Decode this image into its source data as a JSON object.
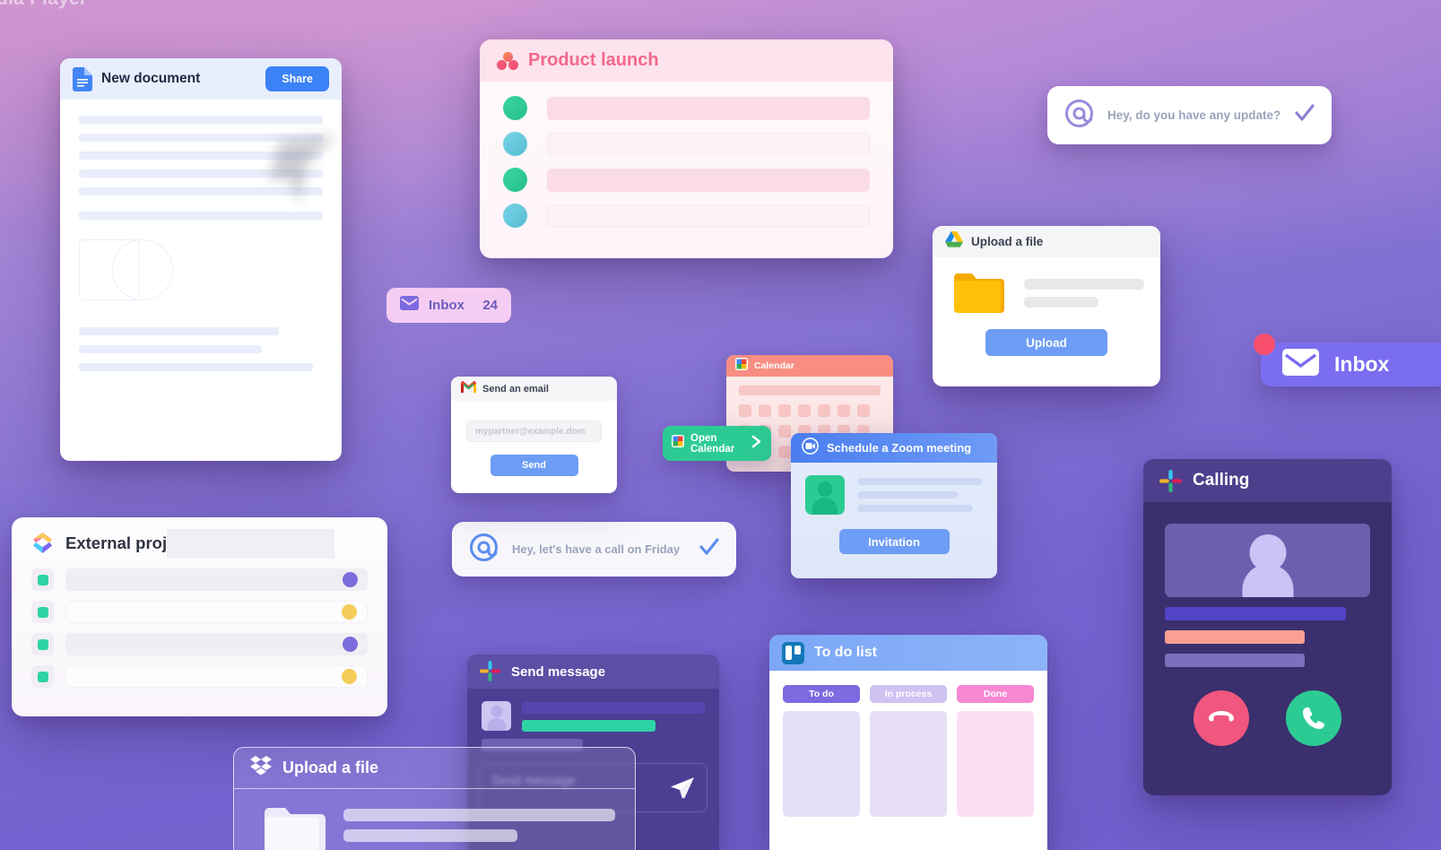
{
  "background": {
    "top_color": "#c48bc8",
    "bottom_color": "#7363cf"
  },
  "bleed_text": "dia Player",
  "document_card": {
    "icon": "google-docs-icon",
    "title": "New document",
    "share_label": "Share"
  },
  "product_launch": {
    "icon": "asana-icon",
    "title": "Product launch",
    "rows": [
      {
        "dot_color": "#2ec99a",
        "bar_color": "#fcdbe8"
      },
      {
        "dot_color": "#65c6dd",
        "bar_color": "#fdf3f7"
      },
      {
        "dot_color": "#2ec99a",
        "bar_color": "#fcdbe8"
      },
      {
        "dot_color": "#65c6dd",
        "bar_color": "#fdf3f7"
      }
    ]
  },
  "inbox_small": {
    "icon": "envelope-icon",
    "label": "Inbox",
    "count": "24"
  },
  "bubble_update": {
    "icon": "at-mention-icon",
    "text": "Hey, do you have any update?",
    "check_color": "#8f7fd8"
  },
  "bubble_call": {
    "icon": "at-mention-icon",
    "text": "Hey, let's have a call on Friday",
    "check_color": "#5b8df0"
  },
  "gdrive_upload": {
    "icon": "google-drive-icon",
    "title": "Upload a file",
    "button_label": "Upload",
    "button_color": "#6d9df4"
  },
  "gmail": {
    "icon": "gmail-icon",
    "title": "Send an email",
    "email_placeholder": "mypartner@example.dom",
    "email_value": "",
    "button_label": "Send"
  },
  "calendar": {
    "icon": "google-calendar-icon",
    "title": "Calendar",
    "header_color": "#f88e83"
  },
  "open_calendar": {
    "icon": "google-calendar-icon",
    "label": "Open Calendar",
    "chevron": "chevron-right-icon",
    "color": "#2dcb94"
  },
  "zoom_meeting": {
    "icon": "video-camera-icon",
    "title": "Schedule a Zoom meeting",
    "button_label": "Invitation"
  },
  "external_project": {
    "icon": "clickup-icon",
    "title": "External project",
    "rows": [
      {
        "check_color": "#2ed3a5",
        "bar_color": "#f0eef3",
        "point_color": "#7b6ddb"
      },
      {
        "check_color": "#2ed3a5",
        "bar_color": "#fcfbfd",
        "point_color": "#f5cc59"
      },
      {
        "check_color": "#2ed3a5",
        "bar_color": "#f0eef3",
        "point_color": "#7b6ddb"
      },
      {
        "check_color": "#2ed3a5",
        "bar_color": "#fcfbfd",
        "point_color": "#f5cc59"
      }
    ]
  },
  "slack_message": {
    "icon": "slack-icon",
    "title": "Send message",
    "message_placeholder": "Send message",
    "message_value": "",
    "send_icon": "paper-plane-icon",
    "bars": [
      {
        "color": "#5546ad"
      },
      {
        "color": "#2ed3a5"
      }
    ]
  },
  "todo_list": {
    "icon": "trello-icon",
    "title": "To do list",
    "columns": [
      {
        "label": "To do",
        "tag_color": "#7b6ae0",
        "tag_text_color": "#ffffff",
        "well_color": "#e4e0f8"
      },
      {
        "label": "In process",
        "tag_color": "#cfc3f3",
        "tag_text_color": "#ffffff",
        "well_color": "#e7e0f6"
      },
      {
        "label": "Done",
        "tag_color": "#f788d3",
        "tag_text_color": "#ffffff",
        "well_color": "#fbe0f4"
      }
    ]
  },
  "dropbox_upload": {
    "icon": "dropbox-icon",
    "title": "Upload a file"
  },
  "inbox_big": {
    "icon": "envelope-icon",
    "label": "Inbox",
    "badge": "notification-dot",
    "color": "#7b6df0"
  },
  "calling": {
    "icon": "slack-icon",
    "title": "Calling",
    "bars": [
      {
        "color": "#5243c7"
      },
      {
        "color": "#fb9f92"
      },
      {
        "color": "#7d6fbb"
      }
    ],
    "decline_icon": "phone-hangup-icon",
    "decline_color": "#f0567e",
    "accept_icon": "phone-icon",
    "accept_color": "#2dcb94"
  }
}
